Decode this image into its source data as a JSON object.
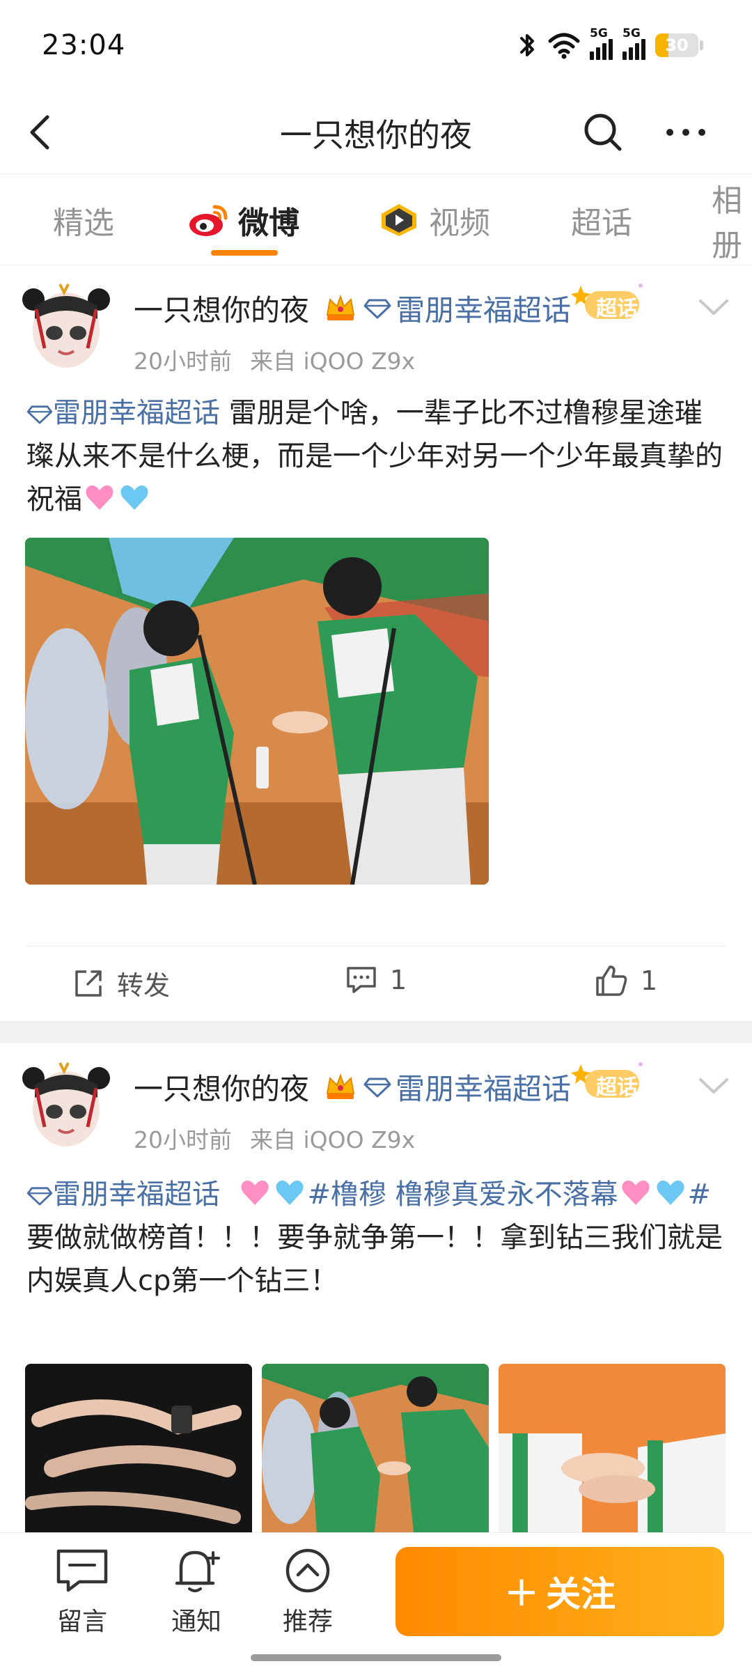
{
  "status_bar": {
    "time": "23:04",
    "battery": "30",
    "battery_level": 0.3,
    "network_label": "5G",
    "icons": [
      "bluetooth-icon",
      "wifi-icon",
      "signal-5g-icon",
      "signal-5g-icon",
      "battery-icon"
    ]
  },
  "nav": {
    "title": "一只想你的夜",
    "icons": [
      "back-icon",
      "search-icon",
      "more-icon"
    ]
  },
  "tabs": [
    {
      "label": "精选",
      "active": false
    },
    {
      "label": "微博",
      "active": true
    },
    {
      "label": "视频",
      "active": false
    },
    {
      "label": "超话",
      "active": false
    },
    {
      "label": "相册",
      "active": false
    }
  ],
  "posts": [
    {
      "user_name": "一只想你的夜",
      "topic": "雷朋幸福超话",
      "badge": "超话",
      "time": "20小时前",
      "source": "来自 iQOO Z9x",
      "text_link": "雷朋幸福超话",
      "text": "  雷朋是个啥，一辈子比不过橹穆星途璀璨从来不是什么梗，而是一个少年对另一个少年最真挚的祝福",
      "photo_count": 1,
      "repost_label": "转发",
      "comment_count": "1",
      "like_count": "1"
    },
    {
      "user_name": "一只想你的夜",
      "topic": "雷朋幸福超话",
      "badge": "超话",
      "time": "20小时前",
      "source": "来自 iQOO Z9x",
      "text_link": "雷朋幸福超话",
      "hashtag": "#橹穆 橹穆真爱永不落幕",
      "hashtag_end": "#",
      "text_line2": "要做就做榜首！！！要争就争第一！！拿到钻三我们就是内娱真人cp第一个钻三！",
      "photo_count": 3
    }
  ],
  "bottom_bar": {
    "comment_label": "留言",
    "notify_label": "通知",
    "recommend_label": "推荐",
    "follow_label": "关注",
    "follow_plus": "+"
  },
  "colors": {
    "accent": "#ff8200",
    "link": "#4a6fa5",
    "follow_gradient_start": "#ff8a00",
    "follow_gradient_end": "#ffb01a",
    "battery": "#f6b400"
  }
}
